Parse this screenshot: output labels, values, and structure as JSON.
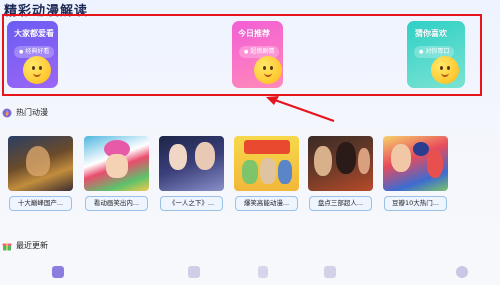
{
  "section_top_title": "精彩动漫解读",
  "feature_cards": [
    {
      "title": "大家都爱看",
      "tag": "经典好看"
    },
    {
      "title": "今日推荐",
      "tag": "超燃剧情"
    },
    {
      "title": "猜你喜欢",
      "tag": "对你胃口"
    }
  ],
  "hot_section": {
    "title": "热门动漫",
    "icon": "flame-icon"
  },
  "hot_items": [
    {
      "caption": "十大巅峰国产..."
    },
    {
      "caption": "看动画笑出内..."
    },
    {
      "caption": "《一人之下》..."
    },
    {
      "caption": "爆笑高能动漫..."
    },
    {
      "caption": "盘点三部超人..."
    },
    {
      "caption": "豆瓣10大热门..."
    }
  ],
  "recent_section": {
    "title": "最近更新",
    "icon": "gift-icon"
  },
  "bottom_nav": [
    "home-icon",
    "bookmark-icon",
    "theater-icon",
    "mail-icon",
    "cloud-icon"
  ],
  "colors": {
    "highlight": "#e8141b",
    "card1": "#7b5ff4",
    "card2": "#f35ed7",
    "card3": "#2fd0c6"
  }
}
